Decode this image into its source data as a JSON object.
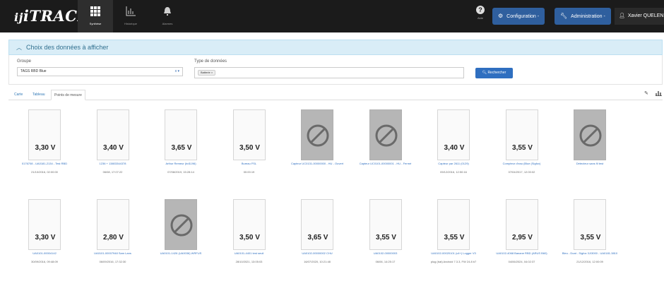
{
  "app": {
    "logo_prefix": "ij",
    "logo_main": "iTRACK"
  },
  "nav": [
    {
      "label": "Synthèse",
      "icon": "grid-icon"
    },
    {
      "label": "Historique",
      "icon": "chart-icon"
    },
    {
      "label": "Alarmes",
      "icon": "bell-icon"
    }
  ],
  "help": {
    "label": "Aide"
  },
  "toolbar": {
    "configuration": "Configuration -",
    "administration": "Administration -",
    "user": "Xavier QUELEN"
  },
  "panel": {
    "title": "Choix des données à afficher",
    "group_label": "Groupe",
    "group_value": "TAGS RBD Blue",
    "group_controls": "x ▾",
    "type_label": "Type de données",
    "type_chip": "Batterie  ×",
    "search_button": "Rechercher"
  },
  "tabs": [
    "Carte",
    "Tableau",
    "Points de mesure"
  ],
  "cards_row1": [
    {
      "value": "3,30 V",
      "name": "0176708 - UA0181-2134 - Test RBD",
      "date": "21/10/2016, 02:00:00",
      "unavailable": false
    },
    {
      "value": "3,40 V",
      "name": "1236 + 13803344378",
      "date": "06/08, 17:07:22",
      "unavailable": false
    },
    {
      "value": "3,65 V",
      "name": "Arthur Remeur (bd1196)",
      "date": "07/08/2019, 15:28:14",
      "unavailable": false
    },
    {
      "value": "3,50 V",
      "name": "Bureau FSL",
      "date": "00:00:19",
      "unavailable": false
    },
    {
      "value": "",
      "name": "Capteur UC0131-00000000 - HU - Ouvert",
      "date": "",
      "unavailable": true
    },
    {
      "value": "",
      "name": "Capteur UC0101-00000001 - HU - Fermé",
      "date": "",
      "unavailable": true
    },
    {
      "value": "3,40 V",
      "name": "Capteur par 2611 (0129)",
      "date": "09/12/2016, 12:50:16",
      "unavailable": false
    },
    {
      "value": "3,55 V",
      "name": "Compteur d'eau (Blue (Sigfox)",
      "date": "07/04/2017, 12:00:02",
      "unavailable": false
    },
    {
      "value": "",
      "name": "Détecteur sans fil test",
      "date": "",
      "unavailable": true
    }
  ],
  "cards_row2": [
    {
      "value": "3,30 V",
      "name": "UA0101-00004142",
      "date": "30/09/2016, 09:48:09",
      "unavailable": false
    },
    {
      "value": "2,80 V",
      "name": "UA0101-00007948 Sam Lans",
      "date": "06/09/2016, 17:32:30",
      "unavailable": false
    },
    {
      "value": "",
      "name": "UA0101-1426 (UA0036) WRFUS",
      "date": "",
      "unavailable": true
    },
    {
      "value": "3,50 V",
      "name": "UA0101-4401 test seuil",
      "date": "28/10/2021, 13:05:03",
      "unavailable": false
    },
    {
      "value": "3,65 V",
      "name": "UA0102-00000002 CHU",
      "date": "16/07/2020, 10:21:48",
      "unavailable": false
    },
    {
      "value": "3,55 V",
      "name": "UA0102-00000003",
      "date": "06/06, 14:25:17",
      "unavailable": false
    },
    {
      "value": "3,55 V",
      "name": "UA0102-00020101 (v4+) Logger V3",
      "date": "plug (bat) Android 7.3.3, FW 24.8 b7",
      "unavailable": false
    },
    {
      "value": "2,95 V",
      "name": "UA0102-4068 Banane RBD (ARUS B60)",
      "date": "04/06/2024, 04:02:37",
      "unavailable": false
    },
    {
      "value": "3,55 V",
      "name": "Bleu - Doat - Sigfox 3J/3000 - UA0181-3810",
      "date": "21/12/2016, 12:00:09",
      "unavailable": false
    }
  ]
}
